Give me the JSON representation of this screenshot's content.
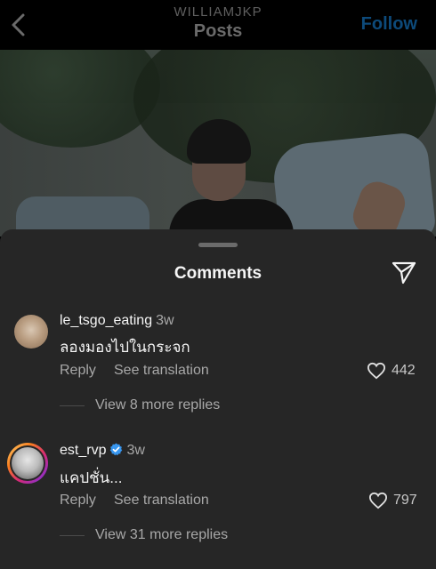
{
  "header": {
    "account": "WILLIAMJKP",
    "title": "Posts",
    "follow_label": "Follow"
  },
  "sheet": {
    "title": "Comments"
  },
  "comments": [
    {
      "username": "le_tsgo_eating",
      "time": "3w",
      "verified": false,
      "text": "ลองมองไปในกระจก",
      "reply_label": "Reply",
      "translate_label": "See translation",
      "likes": "442",
      "more_replies": "View 8 more replies"
    },
    {
      "username": "est_rvp",
      "time": "3w",
      "verified": true,
      "text": "แคปชั่น...",
      "reply_label": "Reply",
      "translate_label": "See translation",
      "likes": "797",
      "more_replies": "View 31 more replies"
    }
  ],
  "colors": {
    "sheet_bg": "#262626",
    "primary_text": "#f5f5f5",
    "secondary_text": "#a8a8a8",
    "verified_blue": "#3897f0"
  }
}
